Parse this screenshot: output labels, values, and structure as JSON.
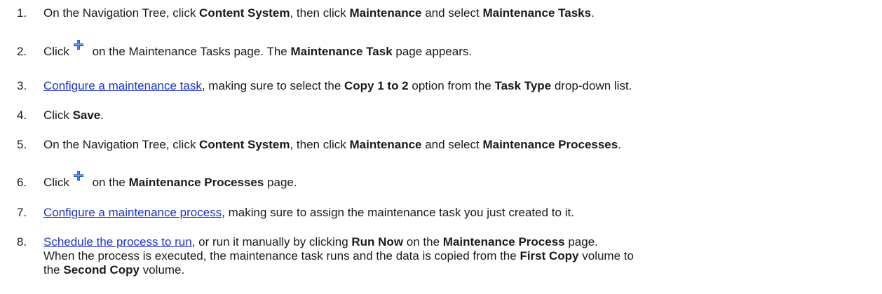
{
  "steps": [
    {
      "number": "1.",
      "parts": [
        "On the Navigation Tree, click ",
        "Content System",
        ", then click ",
        "Maintenance",
        " and select ",
        "Maintenance Tasks",
        "."
      ]
    },
    {
      "number": "2.",
      "parts": [
        "Click",
        " on the Maintenance Tasks page. The ",
        "Maintenance Task",
        " page appears."
      ],
      "icon": "plus-icon"
    },
    {
      "number": "3.",
      "parts": [
        "Configure a maintenance task",
        ", making sure to select the ",
        "Copy 1 to 2",
        " option from the ",
        "Task Type",
        " drop-down list."
      ]
    },
    {
      "number": "4.",
      "parts": [
        "Click ",
        "Save",
        "."
      ]
    },
    {
      "number": "5.",
      "parts": [
        "On the Navigation Tree, click ",
        "Content System",
        ", then click ",
        "Maintenance",
        " and select ",
        "Maintenance Processes",
        "."
      ]
    },
    {
      "number": "6.",
      "parts": [
        "Click",
        " on the ",
        "Maintenance Processes",
        " page."
      ],
      "icon": "plus-icon"
    },
    {
      "number": "7.",
      "parts": [
        "Configure a maintenance process",
        ", making sure to assign the maintenance task you just created to it."
      ]
    },
    {
      "number": "8.",
      "parts": [
        "Schedule the process to run",
        ", or run it manually by clicking ",
        "Run Now",
        " on the ",
        "Maintenance Process",
        " page."
      ],
      "lines": [
        [
          "When the process is executed, the maintenance task runs and the data is copied from the ",
          "First Copy",
          " volume to"
        ],
        [
          "the ",
          "Second Copy",
          " volume."
        ]
      ]
    }
  ],
  "colors": {
    "text": "#1a1a1a",
    "link": "#1f33cc",
    "plus_icon": "#2a5bd7"
  }
}
